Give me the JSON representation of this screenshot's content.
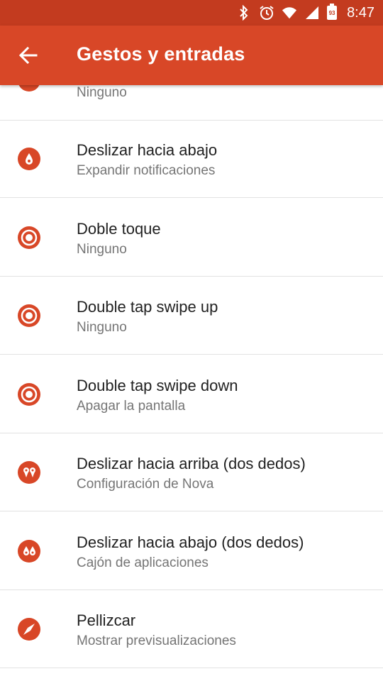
{
  "status_bar": {
    "icons": [
      "bluetooth-icon",
      "alarm-icon",
      "wifi-icon",
      "signal-icon",
      "battery-icon"
    ],
    "battery_level": "93",
    "time": "8:47"
  },
  "app_bar": {
    "title": "Gestos y entradas",
    "back_icon": "arrow-back-icon"
  },
  "colors": {
    "status_bar": "#c33b1f",
    "app_bar": "#d84727",
    "accent": "#d84727",
    "title_text": "#212121",
    "subtitle_text": "#757575",
    "divider": "#e2e2e2"
  },
  "partial_item": {
    "subtitle": "Ninguno"
  },
  "items": [
    {
      "title": "Deslizar hacia abajo",
      "subtitle": "Expandir notificaciones",
      "icon": "swipe-down-icon"
    },
    {
      "title": "Doble toque",
      "subtitle": "Ninguno",
      "icon": "double-tap-icon"
    },
    {
      "title": "Double tap swipe up",
      "subtitle": "Ninguno",
      "icon": "double-tap-icon"
    },
    {
      "title": "Double tap swipe down",
      "subtitle": "Apagar la pantalla",
      "icon": "double-tap-icon"
    },
    {
      "title": "Deslizar hacia arriba (dos dedos)",
      "subtitle": "Configuración de Nova",
      "icon": "two-finger-swipe-up-icon"
    },
    {
      "title": "Deslizar hacia abajo (dos dedos)",
      "subtitle": "Cajón de aplicaciones",
      "icon": "two-finger-swipe-down-icon"
    },
    {
      "title": "Pellizcar",
      "subtitle": "Mostrar previsualizaciones",
      "icon": "pinch-icon"
    }
  ]
}
